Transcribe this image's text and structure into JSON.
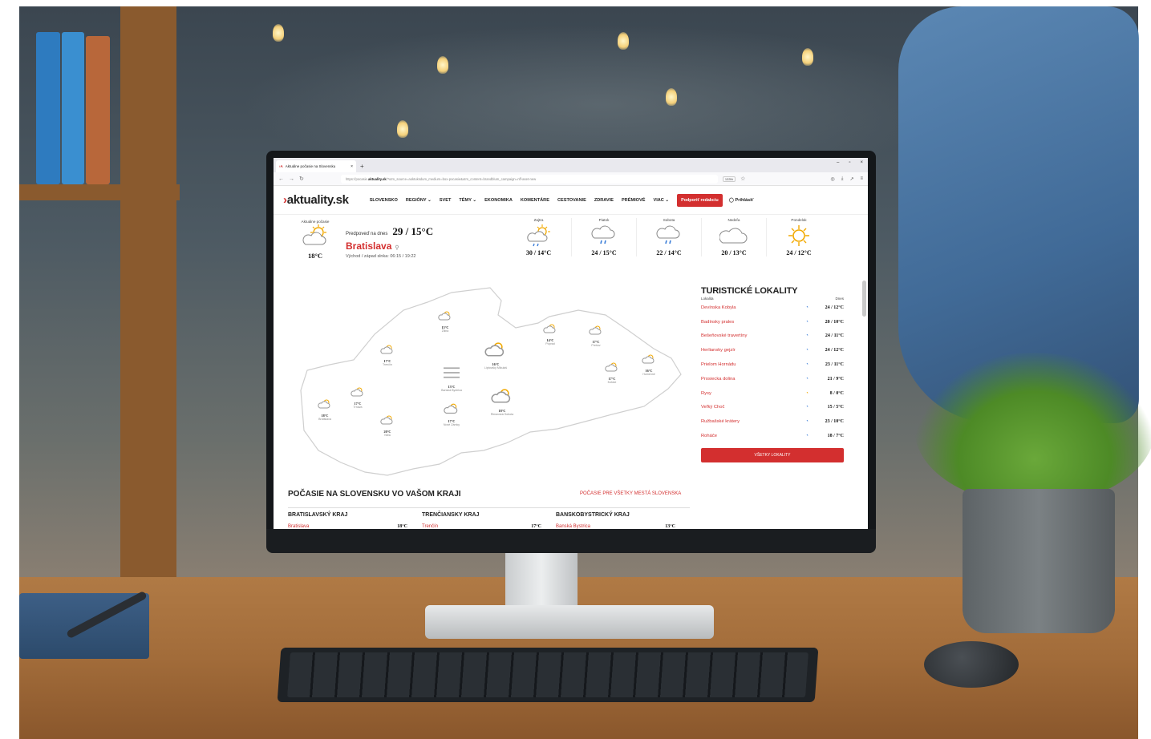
{
  "browser": {
    "tab_title": "Aktuálne počasie na Slovensku",
    "url_prefix": "https://pocasie.",
    "url_domain": "aktuality.sk",
    "url_rest": "/?utm_source=aoktuksdum_medium=box-pocasie&utm_content=brandblum_campaign=nff-aset-new",
    "zoom": "133%"
  },
  "site": {
    "logo_text": "aktuality.sk",
    "menu": [
      "SLOVENSKO",
      "REGIÓNY ⌄",
      "SVET",
      "TÉMY ⌄",
      "EKONOMIKA",
      "KOMENTÁRE",
      "CESTOVANIE",
      "ZDRAVIE",
      "PRÉMIOVÉ",
      "VIAC ⌄"
    ],
    "support_button": "Podporiť redakciu",
    "login": "Prihlásiť"
  },
  "current": {
    "label": "Aktuálne počasie",
    "temp": "18°C",
    "forecast_label": "Predpoveď na dnes",
    "forecast_temp": "29 / 15°C",
    "city": "Bratislava",
    "sun": "Východ / západ slnka: 06:15 / 19:22"
  },
  "days": [
    {
      "name": "Zajtra",
      "temp": "30 / 14°C",
      "icon": "sun-cloud-rain-icon"
    },
    {
      "name": "Piatok",
      "temp": "24 / 15°C",
      "icon": "cloud-rain-icon"
    },
    {
      "name": "Sobota",
      "temp": "22 / 14°C",
      "icon": "cloud-rain-icon"
    },
    {
      "name": "Nedeľa",
      "temp": "20 / 13°C",
      "icon": "cloud-icon"
    },
    {
      "name": "Pondelok",
      "temp": "24 / 12°C",
      "icon": "sun-icon"
    }
  ],
  "map_cities": [
    {
      "temp": "15°C",
      "name": "Žilina"
    },
    {
      "temp": "17°C",
      "name": "Trenčín"
    },
    {
      "temp": "16°C",
      "name": "Liptovský Mikuláš"
    },
    {
      "temp": "14°C",
      "name": "Poprad"
    },
    {
      "temp": "17°C",
      "name": "Prešov"
    },
    {
      "temp": "16°C",
      "name": "Humenné"
    },
    {
      "temp": "17°C",
      "name": "Košice"
    },
    {
      "temp": "13°C",
      "name": "Banská Bystrica"
    },
    {
      "temp": "17°C",
      "name": "Trnava"
    },
    {
      "temp": "18°C",
      "name": "Bratislava"
    },
    {
      "temp": "20°C",
      "name": "Nitra"
    },
    {
      "temp": "17°C",
      "name": "Nové Zámky"
    },
    {
      "temp": "18°C",
      "name": "Rimavská Sobota"
    }
  ],
  "tourist": {
    "title": "TURISTICKÉ LOKALITY",
    "col_left": "Lokalita",
    "col_right": "Dnes",
    "items": [
      {
        "name": "Devínska Kobyla",
        "temp": "24 / 12°C"
      },
      {
        "name": "Badínsky prales",
        "temp": "20 / 10°C"
      },
      {
        "name": "Bešeňovské travertíny",
        "temp": "24 / 11°C"
      },
      {
        "name": "Herliansky gejzír",
        "temp": "24 / 12°C"
      },
      {
        "name": "Prielom Hornádu",
        "temp": "23 / 11°C"
      },
      {
        "name": "Prosiecka dolina",
        "temp": "21 / 9°C"
      },
      {
        "name": "Rysy",
        "temp": "8 / 0°C"
      },
      {
        "name": "Veľký Choč",
        "temp": "15 / 5°C"
      },
      {
        "name": "Ružbašské krátery",
        "temp": "23 / 10°C"
      },
      {
        "name": "Roháče",
        "temp": "18 / 7°C"
      }
    ],
    "all_button": "VŠETKY LOKALITY"
  },
  "regions": {
    "title": "POČASIE NA SLOVENSKU VO VAŠOM KRAJI",
    "link": "POČASIE PRE VŠETKY MESTÁ SLOVENSKA",
    "items": [
      {
        "name": "BRATISLAVSKÝ KRAJ",
        "city": "Bratislava",
        "temp": "18°C"
      },
      {
        "name": "TRENČIANSKY KRAJ",
        "city": "Trenčín",
        "temp": "17°C"
      },
      {
        "name": "BANSKOBYSTRICKÝ KRAJ",
        "city": "Banská Bystrica",
        "temp": "13°C"
      }
    ]
  }
}
